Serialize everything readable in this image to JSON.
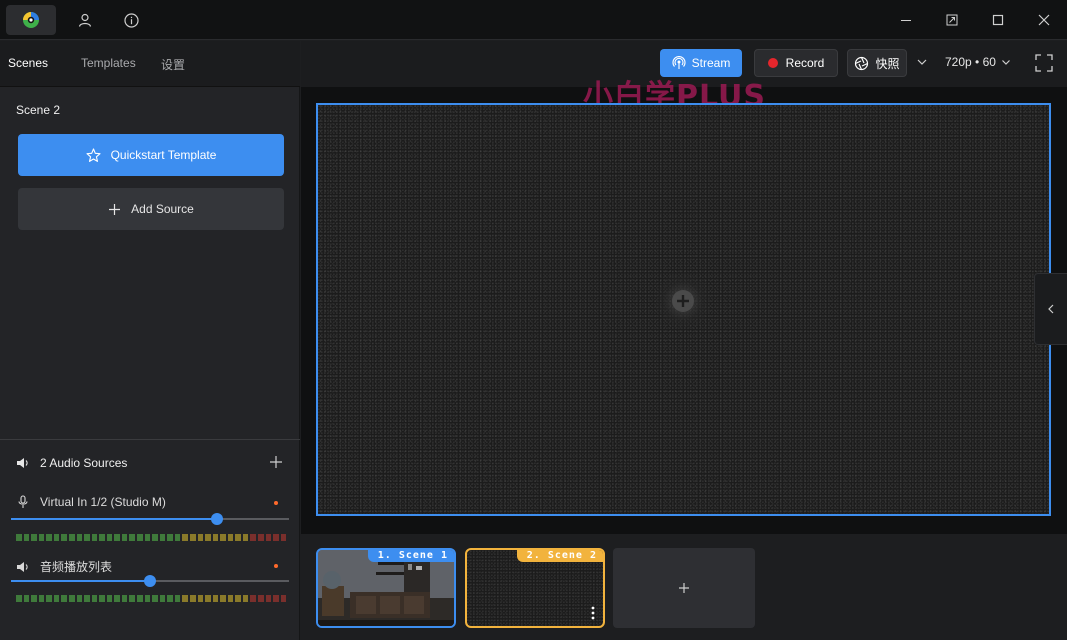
{
  "left_tabs": [
    "Scenes",
    "Templates",
    "设置"
  ],
  "scene_panel": {
    "title": "Scene 2",
    "quickstart_label": "Quickstart Template",
    "add_source_label": "Add Source"
  },
  "audio": {
    "header": "2 Audio Sources",
    "tracks": [
      {
        "name": "Virtual In 1/2 (Studio M)",
        "icon": "microphone-icon",
        "level": 0.74
      },
      {
        "name": "音频播放列表",
        "icon": "speaker-icon",
        "level": 0.5
      }
    ]
  },
  "toolbar": {
    "stream_label": "Stream",
    "record_label": "Record",
    "snapshot_label": "快照",
    "resolution": "720p • 60"
  },
  "watermark": "小白学PLUS",
  "scenes": [
    {
      "label": "1. Scene 1"
    },
    {
      "label": "2. Scene 2"
    }
  ],
  "colors": {
    "accent": "#3d8ef0",
    "record": "#e5262c",
    "selected_scene": "#f2b33d"
  }
}
